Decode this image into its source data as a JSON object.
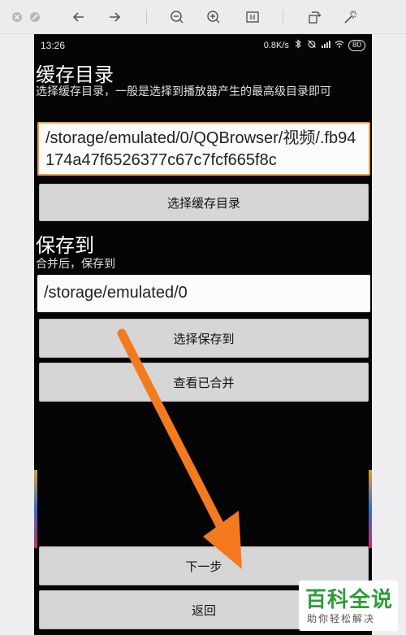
{
  "viewer": {
    "icons": [
      "close-icon",
      "minimize-icon",
      "back-arrow-icon",
      "forward-arrow-icon",
      "zoom-out-icon",
      "zoom-in-icon",
      "actual-size-icon",
      "rotate-icon",
      "magic-wand-icon"
    ]
  },
  "status_bar": {
    "time": "13:26",
    "speed": "0.8K/s",
    "battery": "80"
  },
  "cache_section": {
    "title": "缓存目录",
    "description": "选择缓存目录，一般是选择到播放器产生的最高级目录即可",
    "path_value": "/storage/emulated/0/QQBrowser/视频/.fb94174a47f6526377c67c7fcf665f8c",
    "select_button": "选择缓存目录"
  },
  "save_section": {
    "title": "保存到",
    "description": "合并后，保存到",
    "path_value": "/storage/emulated/0",
    "select_button": "选择保存到",
    "view_button": "查看已合并"
  },
  "bottom": {
    "next_button": "下一步",
    "back_button": "返回"
  },
  "watermark": {
    "main": "百科全说",
    "sub": "助你轻松解决"
  },
  "colors": {
    "annotation_arrow": "#f47a20",
    "path_box_border": "#f0a046",
    "watermark_green": "#2d9c3a"
  }
}
